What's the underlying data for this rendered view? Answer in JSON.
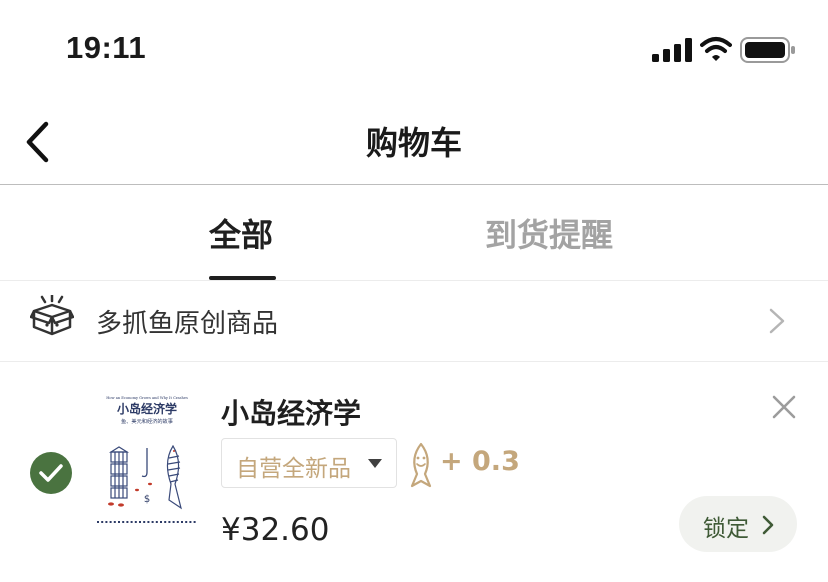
{
  "status_bar": {
    "time": "19:11"
  },
  "nav": {
    "title": "购物车"
  },
  "tabs": [
    {
      "label": "全部",
      "active": true
    },
    {
      "label": "到货提醒",
      "active": false
    }
  ],
  "section": {
    "label": "多抓鱼原创商品"
  },
  "cart_item": {
    "selected": true,
    "title": "小岛经济学",
    "cover": {
      "tagline": "How an Economy Grows and Why It Crashes",
      "title": "小岛经济学",
      "subtitle": "鱼、美元和经济的故事"
    },
    "variant": "自营全新品",
    "points": "+ 0.3",
    "price": "¥32.60",
    "lock_label": "锁定"
  },
  "colors": {
    "accent_green": "#4a7340",
    "gold": "#c4a77c",
    "divider": "#bdbdbd"
  }
}
